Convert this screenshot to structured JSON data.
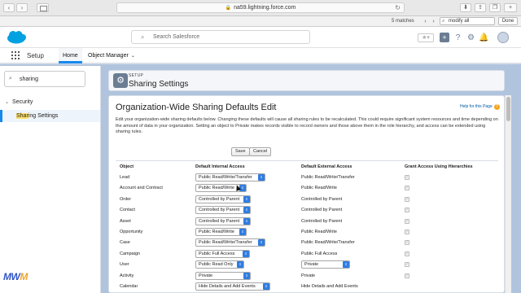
{
  "browser": {
    "url": "na59.lightning.force.com",
    "find": {
      "matches": "5 matches",
      "query": "modify all",
      "done": "Done"
    }
  },
  "header": {
    "search_placeholder": "Search Salesforce"
  },
  "nav": {
    "app_name": "Setup",
    "tabs": [
      "Home",
      "Object Manager"
    ]
  },
  "sidebar": {
    "quickfind_value": "sharing",
    "section": "Security",
    "item_highlight": "Shar",
    "item_rest": "ing Settings"
  },
  "page_header": {
    "kicker": "SETUP",
    "title": "Sharing Settings"
  },
  "owd": {
    "title": "Organization-Wide Sharing Defaults Edit",
    "help": "Help for this Page",
    "intro": "Edit your organization-wide sharing defaults below. Changing these defaults will cause all sharing rules to be recalculated. This could require significant system resources and time depending on the amount of data in your organization. Setting an object to Private makes records visible to record owners and those above them in the role hierarchy, and access can be extended using sharing rules.",
    "save": "Save",
    "cancel": "Cancel",
    "columns": [
      "Object",
      "Default Internal Access",
      "Default External Access",
      "Grant Access Using Hierarchies"
    ],
    "rows": [
      {
        "object": "Lead",
        "internal": "Public Read/Write/Transfer",
        "external": "Public Read/Write/Transfer",
        "external_is_select": false
      },
      {
        "object": "Account and Contract",
        "internal": "Public Read/Write",
        "external": "Public Read/Write",
        "external_is_select": false
      },
      {
        "object": "Order",
        "internal": "Controlled by Parent",
        "external": "Controlled by Parent",
        "external_is_select": false
      },
      {
        "object": "Contact",
        "internal": "Controlled by Parent",
        "external": "Controlled by Parent",
        "external_is_select": false
      },
      {
        "object": "Asset",
        "internal": "Controlled by Parent",
        "external": "Controlled by Parent",
        "external_is_select": false
      },
      {
        "object": "Opportunity",
        "internal": "Public Read/Write",
        "external": "Public Read/Write",
        "external_is_select": false
      },
      {
        "object": "Case",
        "internal": "Public Read/Write/Transfer",
        "external": "Public Read/Write/Transfer",
        "external_is_select": false
      },
      {
        "object": "Campaign",
        "internal": "Public Full Access",
        "external": "Public Full Access",
        "external_is_select": false
      },
      {
        "object": "User",
        "internal": "Public Read Only",
        "external": "Private",
        "external_is_select": true
      },
      {
        "object": "Activity",
        "internal": "Private",
        "external": "Private",
        "external_is_select": false
      },
      {
        "object": "Calendar",
        "internal": "Hide Details and Add Events",
        "external": "Hide Details and Add Events",
        "external_is_select": false
      }
    ]
  },
  "watermark": {
    "a": "MW",
    "b": "M"
  },
  "colors": {
    "brand": "#1589ee",
    "select_arrow": "#2f7de1",
    "setup_icon": "#6b7d93"
  }
}
